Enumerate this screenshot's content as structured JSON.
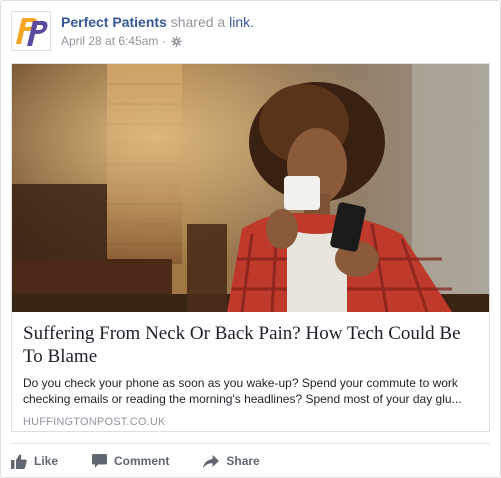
{
  "post": {
    "page_name": "Perfect Patients",
    "action_text": "shared a",
    "link_word": "link.",
    "timestamp": "April 28 at 6:45am",
    "separator": "·",
    "privacy_icon": "gear-icon"
  },
  "link_card": {
    "title": "Suffering From Neck Or Back Pain? How Tech Could Be To Blame",
    "description": "Do you check your phone as soon as you wake-up? Spend your commute to work checking emails or reading the morning's headlines? Spend most of your day glu...",
    "domain": "HUFFINGTONPOST.CO.UK",
    "image_subject": "woman-drinking-coffee-looking-at-phone"
  },
  "actions": {
    "like_label": "Like",
    "comment_label": "Comment",
    "share_label": "Share"
  },
  "colors": {
    "link_blue": "#365899",
    "muted_gray": "#90949c",
    "action_gray": "#606770",
    "logo_orange": "#f5a623",
    "logo_purple": "#5b4aa0"
  }
}
